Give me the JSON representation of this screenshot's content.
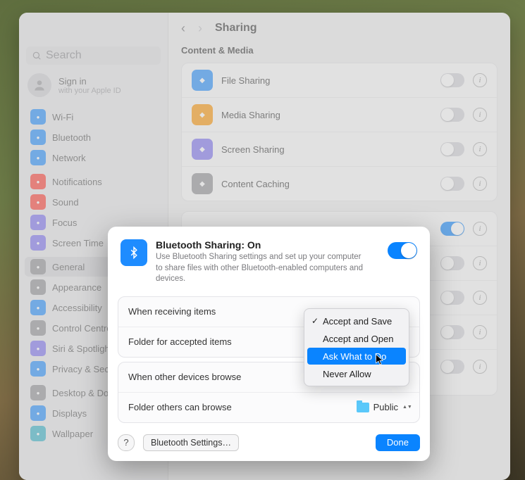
{
  "window_title": "Sharing",
  "search_placeholder": "Search",
  "account": {
    "title": "Sign in",
    "subtitle": "with your Apple ID"
  },
  "sidebar_groups": [
    [
      {
        "icon": "wifi-icon",
        "color": "blue",
        "label": "Wi-Fi"
      },
      {
        "icon": "bluetooth-icon",
        "color": "blue",
        "label": "Bluetooth"
      },
      {
        "icon": "network-icon",
        "color": "blue",
        "label": "Network"
      }
    ],
    [
      {
        "icon": "bell-icon",
        "color": "red2",
        "label": "Notifications"
      },
      {
        "icon": "sound-icon",
        "color": "red2",
        "label": "Sound"
      },
      {
        "icon": "focus-icon",
        "color": "purple",
        "label": "Focus"
      },
      {
        "icon": "hourglass-icon",
        "color": "purple",
        "label": "Screen Time"
      }
    ],
    [
      {
        "icon": "gear-icon",
        "color": "grey",
        "label": "General",
        "selected": true
      },
      {
        "icon": "appearance-icon",
        "color": "grey",
        "label": "Appearance"
      },
      {
        "icon": "accessibility-icon",
        "color": "blue",
        "label": "Accessibility"
      },
      {
        "icon": "control-centre-icon",
        "color": "grey",
        "label": "Control Centre"
      },
      {
        "icon": "siri-icon",
        "color": "purple",
        "label": "Siri & Spotlight"
      },
      {
        "icon": "privacy-icon",
        "color": "blue",
        "label": "Privacy & Security"
      }
    ],
    [
      {
        "icon": "desktop-icon",
        "color": "grey",
        "label": "Desktop & Dock"
      },
      {
        "icon": "displays-icon",
        "color": "blue",
        "label": "Displays"
      },
      {
        "icon": "wallpaper-icon",
        "color": "teal",
        "label": "Wallpaper"
      }
    ]
  ],
  "section": "Content & Media",
  "content_rows": [
    {
      "icon": "folder-icon",
      "color": "blue",
      "label": "File Sharing",
      "on": false
    },
    {
      "icon": "media-icon",
      "color": "orange",
      "label": "Media Sharing",
      "on": false
    },
    {
      "icon": "screen-icon",
      "color": "purple",
      "label": "Screen Sharing",
      "on": false
    },
    {
      "icon": "cache-icon",
      "color": "grey",
      "label": "Content Caching",
      "on": false
    }
  ],
  "services_rows": [
    {
      "label": "",
      "on": true
    },
    {
      "label": "",
      "on": false
    },
    {
      "label": "",
      "on": false
    },
    {
      "label": "",
      "on": false
    },
    {
      "label": "",
      "on": false
    }
  ],
  "modal": {
    "title": "Bluetooth Sharing: On",
    "description": "Use Bluetooth Sharing settings and set up your computer to share files with other Bluetooth-enabled computers and devices.",
    "toggle_on": true,
    "row1_label": "When receiving items",
    "row2_label": "Folder for accepted items",
    "row3_label": "When other devices browse",
    "row4_label": "Folder others can browse",
    "folder_value": "Public",
    "footer_help": "?",
    "footer_settings": "Bluetooth Settings…",
    "footer_done": "Done"
  },
  "dropdown": {
    "items": [
      "Accept and Save",
      "Accept and Open",
      "Ask What to Do",
      "Never Allow"
    ],
    "checked_index": 0,
    "highlighted_index": 2
  }
}
